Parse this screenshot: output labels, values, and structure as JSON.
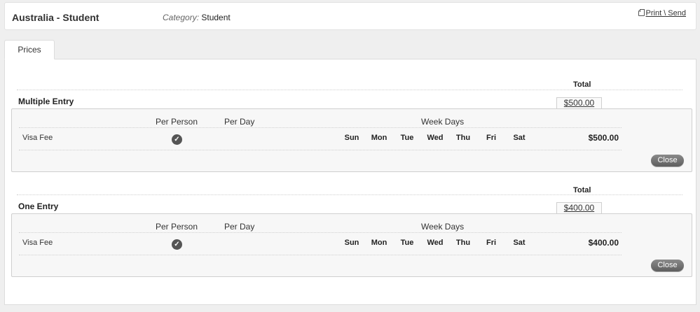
{
  "header": {
    "title": "Australia - Student",
    "category_label": "Category:",
    "category_value": "Student",
    "print_label": "Print \\ Send"
  },
  "tabs": [
    {
      "label": "Prices"
    }
  ],
  "sections": [
    {
      "title": "Multiple Entry",
      "total_label": "Total",
      "total_value": "$500.00",
      "col_per_person": "Per Person",
      "col_per_day": "Per Day",
      "col_week_days": "Week Days",
      "row_label": "Visa Fee",
      "days": [
        "Sun",
        "Mon",
        "Tue",
        "Wed",
        "Thu",
        "Fri",
        "Sat"
      ],
      "amount": "$500.00",
      "close_label": "Close"
    },
    {
      "title": "One Entry",
      "total_label": "Total",
      "total_value": "$400.00",
      "col_per_person": "Per Person",
      "col_per_day": "Per Day",
      "col_week_days": "Week Days",
      "row_label": "Visa Fee",
      "days": [
        "Sun",
        "Mon",
        "Tue",
        "Wed",
        "Thu",
        "Fri",
        "Sat"
      ],
      "amount": "$400.00",
      "close_label": "Close"
    }
  ]
}
